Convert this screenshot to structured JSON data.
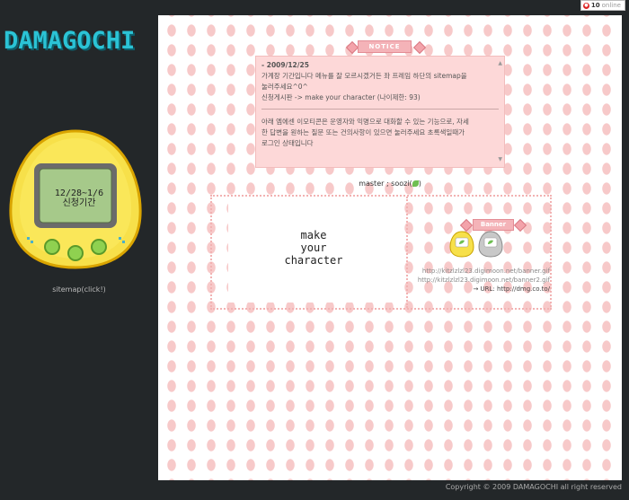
{
  "header": {
    "online_count": "10",
    "online_label": "online"
  },
  "sidebar": {
    "logo": "DAMAGOCHI",
    "device_screen_line1": "12/28~1/6",
    "device_screen_line2": "신청기간",
    "sitemap_link": "sitemap(click!)"
  },
  "notice": {
    "title": "NOTICE",
    "date": "- 2009/12/25",
    "line1": "가계장 기간입니다 메뉴를 잘 모르시겠거든 좌 프레임 하단의 sitemap을",
    "line2": "눌러주세요^0^",
    "line3": "신청게시판 -> make your character (나이제한: 93)",
    "line4": "아래 엠에센 이모티콘은 운영자와 익명으로 대화할 수 있는 기능으로, 자세",
    "line5": "한 답변을 원하는 질문 또는 건의사항이 있으면 눌러주세요 초록색일때가",
    "line6": "로그인 상태입니다"
  },
  "master": {
    "label": "master ; soozi(",
    "suffix": ")"
  },
  "board": {
    "make_line1": "make",
    "make_line2": "your",
    "make_line3": "character"
  },
  "banner": {
    "title": "Banner",
    "url1": "http://kitzlzlzl23.digimoon.net/banner.gif",
    "url2": "http://kitzlzlzl23.digimoon.net/banner2.gif",
    "url_line": "→ URL: http://dmg.co.to/"
  },
  "footer": {
    "copyright": "Copyright © 2009 DAMAGOCHI all right reserved"
  },
  "colors": {
    "logo": "#2bc3d5",
    "sidebar_bg": "#232729",
    "notice_bg": "#fdd8d8",
    "dot_pink": "#f7c9c9",
    "device_yellow": "#f7e04a",
    "device_screen": "#a6c98a",
    "button_green": "#8fd150"
  }
}
